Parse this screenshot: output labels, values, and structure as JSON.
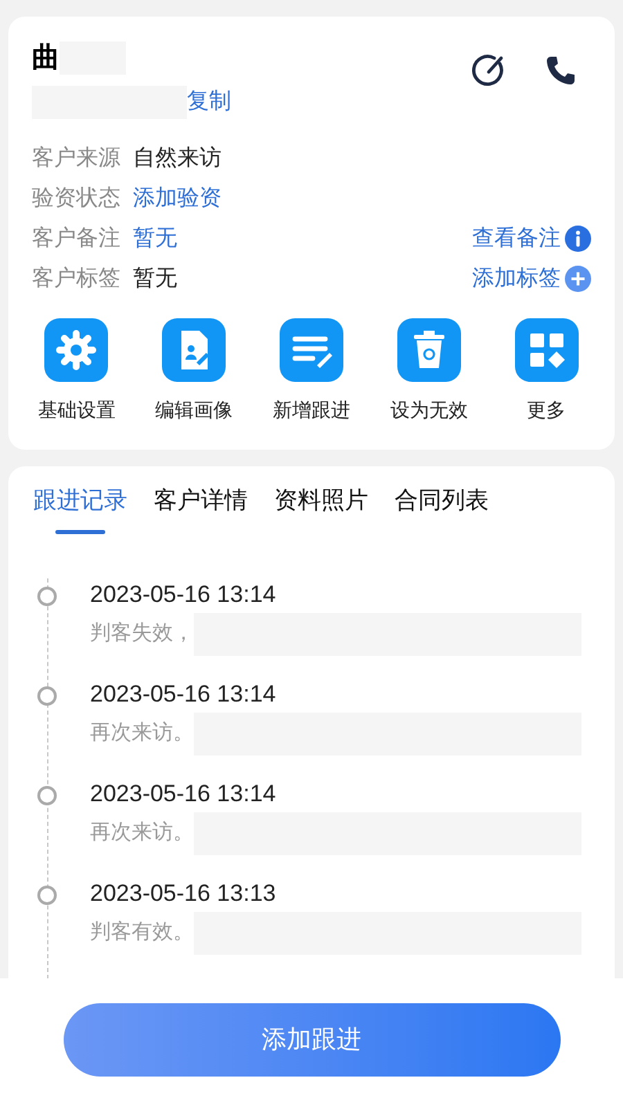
{
  "customer": {
    "name": "曲",
    "copy_link": "复制"
  },
  "fields": [
    {
      "label": "客户来源",
      "value": "自然来访",
      "link": false
    },
    {
      "label": "验资状态",
      "value": "添加验资",
      "link": true
    },
    {
      "label": "客户备注",
      "value": "暂无",
      "link": true,
      "action": {
        "text": "查看备注",
        "kind": "info"
      }
    },
    {
      "label": "客户标签",
      "value": "暂无",
      "link": false,
      "action": {
        "text": "添加标签",
        "kind": "plus"
      }
    }
  ],
  "actions": [
    {
      "label": "基础设置",
      "kind": "gear"
    },
    {
      "label": "编辑画像",
      "kind": "document"
    },
    {
      "label": "新增跟进",
      "kind": "note"
    },
    {
      "label": "设为无效",
      "kind": "trash"
    },
    {
      "label": "更多",
      "kind": "grid"
    }
  ],
  "tabs": [
    {
      "label": "跟进记录",
      "selected": true
    },
    {
      "label": "客户详情",
      "selected": false
    },
    {
      "label": "资料照片",
      "selected": false
    },
    {
      "label": "合同列表",
      "selected": false
    }
  ],
  "timeline": [
    {
      "time": "2023-05-16 13:14",
      "note": "判客失效，"
    },
    {
      "time": "2023-05-16 13:14",
      "note": "再次来访。"
    },
    {
      "time": "2023-05-16 13:14",
      "note": "再次来访。"
    },
    {
      "time": "2023-05-16 13:13",
      "note": "判客有效。"
    }
  ],
  "primary_button": "添加跟进"
}
